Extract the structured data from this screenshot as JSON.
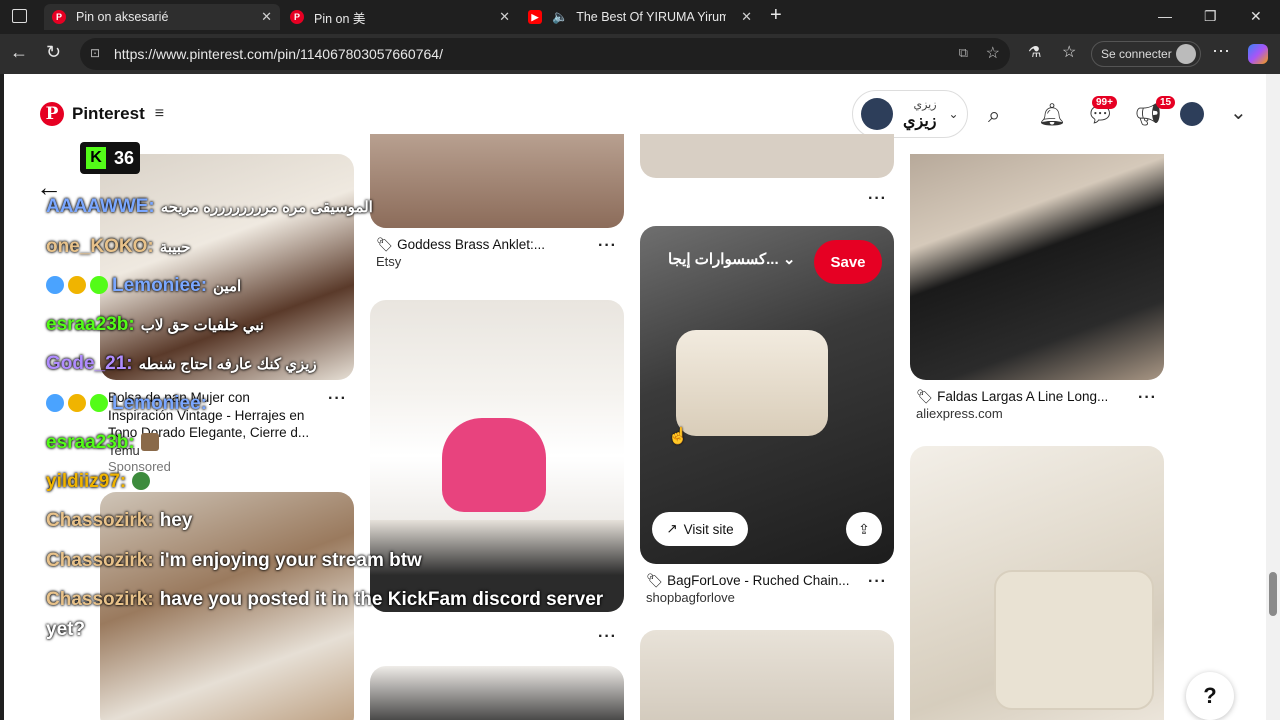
{
  "browser": {
    "tabs": [
      {
        "title": "Pin on aksesarié"
      },
      {
        "title": "Pin on 美"
      },
      {
        "title": "The Best Of YIRUMA Yiruma"
      }
    ],
    "url": "https://www.pinterest.com/pin/114067803057660764/",
    "signin_label": "Se connecter"
  },
  "header": {
    "brand": "Pinterest",
    "user_top": "زيزي",
    "user_bottom": "زيزي",
    "messages_badge": "99+",
    "updates_badge": "15"
  },
  "pins": {
    "c1": {
      "title": "Bolsa de pan Mujer con",
      "line2": "Inspiración Vintage - Herrajes en",
      "line3": "Tono Dorado Elegante, Cierre d...",
      "sub": "Temu",
      "sponsored": "Sponsored"
    },
    "c2": {
      "title": "Goddess Brass Anklet:...",
      "sub": "Etsy"
    },
    "c3": {
      "board": "كسسوارات إيجا...",
      "save": "Save",
      "visit": "Visit site",
      "title": "BagForLove - Ruched Chain...",
      "sub": "shopbagforlove"
    },
    "c4": {
      "title": "Faldas Largas A Line Long...",
      "sub": "aliexpress.com"
    }
  },
  "overlay": {
    "kick_count": "36",
    "messages": [
      {
        "user": "AAAAWWE:",
        "text": "الموسيقى مره مرررررررره مريحه",
        "color": "#7aa7ff"
      },
      {
        "user": "one_KOKO:",
        "text": "حبيبة",
        "color": "#e8c28a"
      },
      {
        "user": "Lemoniee:",
        "text": "امين",
        "color": "#7aa7ff"
      },
      {
        "user": "esraa23b:",
        "text": "نبي خلفيات حق لاب",
        "color": "#53fc18"
      },
      {
        "user": "Gode_21:",
        "text": "زيزي كنك عارفه احتاج شنطه",
        "color": "#b08cff"
      },
      {
        "user": "Lemoniee:",
        "text": "",
        "color": "#7aa7ff"
      },
      {
        "user": "esraa23b:",
        "text": "",
        "color": "#53fc18"
      },
      {
        "user": "yildiiz97:",
        "text": "",
        "color": "#f0b400"
      },
      {
        "user": "Chassozirk:",
        "text": "hey",
        "color": "#e8c28a"
      },
      {
        "user": "Chassozirk:",
        "text": "i'm enjoying your stream btw",
        "color": "#e8c28a"
      },
      {
        "user": "Chassozirk:",
        "text": "have you posted it in the KickFam discord server",
        "color": "#e8c28a"
      },
      {
        "user": "",
        "text": "yet?",
        "color": "#e8c28a"
      }
    ]
  },
  "colors": {
    "pinterest_red": "#e60023",
    "kick_green": "#53fc18"
  }
}
